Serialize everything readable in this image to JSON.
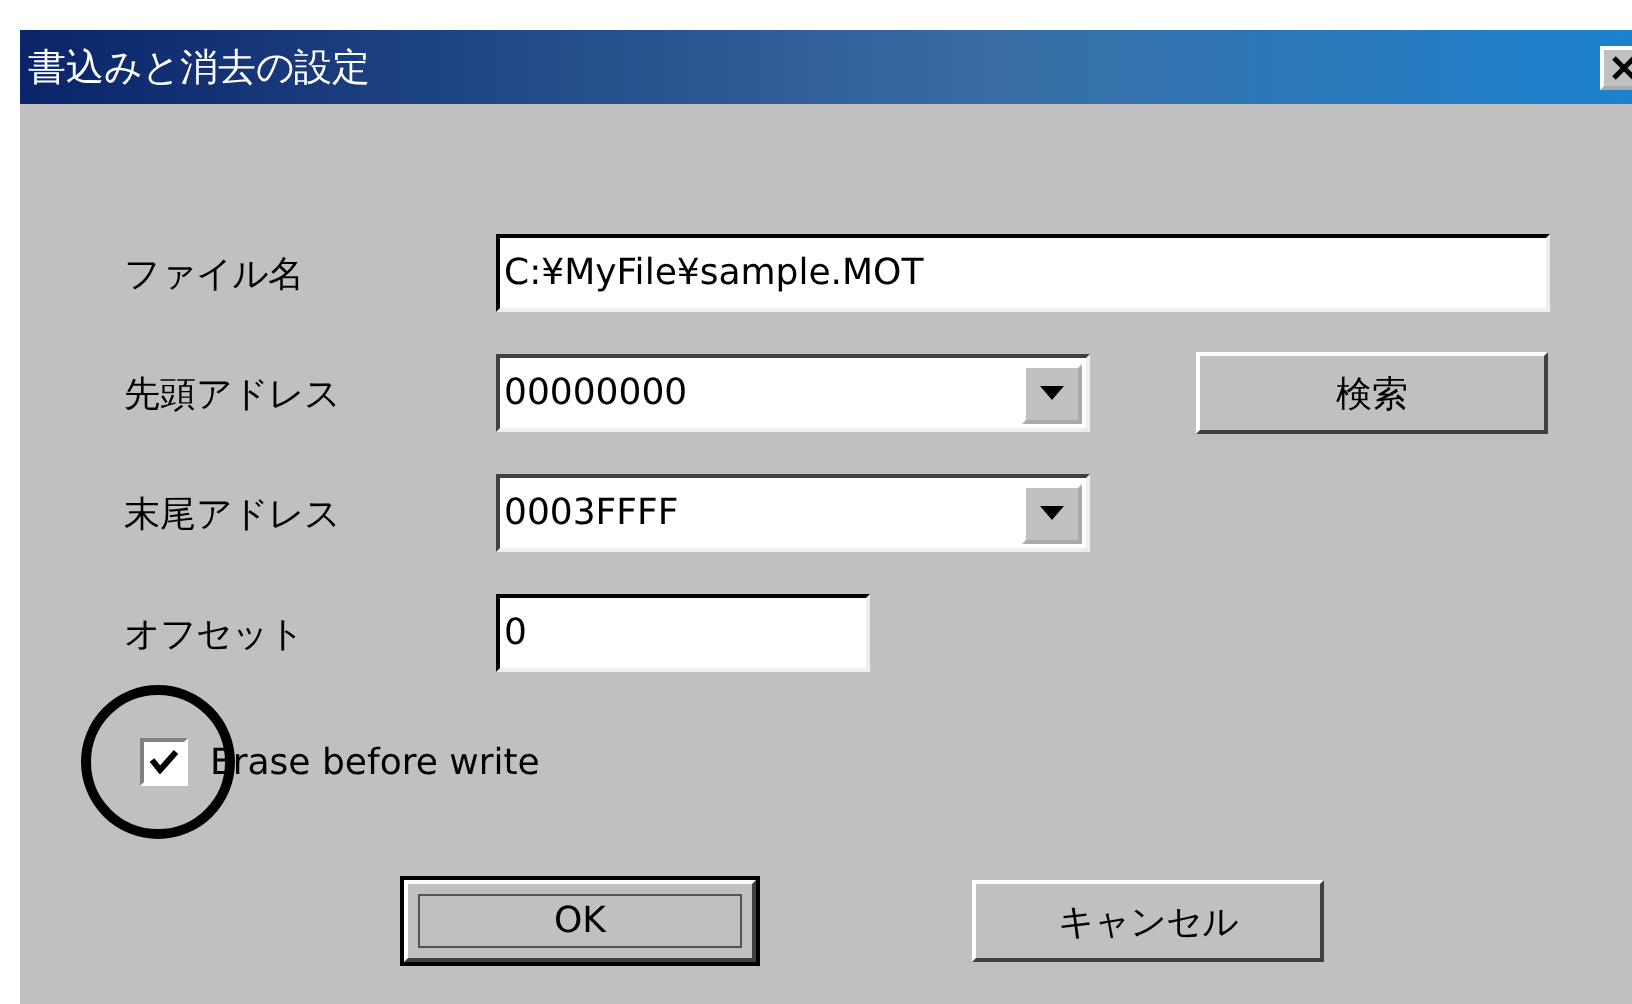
{
  "window": {
    "title": "書込みと消去の設定"
  },
  "fields": [
    {
      "kind": "text",
      "label": "ファイル名",
      "value": "C:¥MyFile¥sample.MOT"
    },
    {
      "kind": "combo",
      "label": "先頭アドレス",
      "value": "00000000",
      "button": "検索"
    },
    {
      "kind": "combo",
      "label": "末尾アドレス",
      "value": "0003FFFF"
    },
    {
      "kind": "short",
      "label": "オフセット",
      "value": "0"
    }
  ],
  "checkbox": {
    "label": "Erase before write",
    "checked": true
  },
  "buttons": [
    {
      "label": "OK",
      "default": true
    },
    {
      "label": "キャンセル",
      "default": false
    }
  ]
}
